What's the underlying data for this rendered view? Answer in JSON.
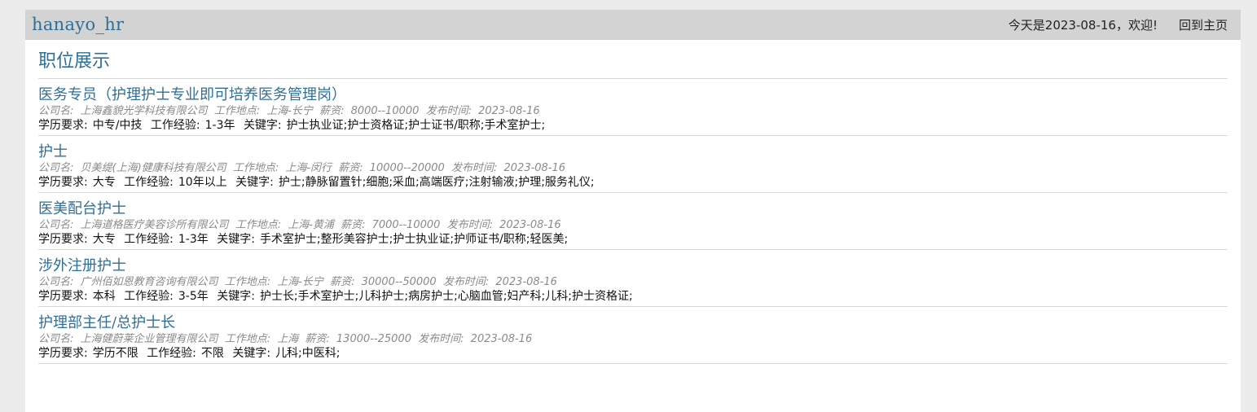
{
  "header": {
    "brand": "hanayo_hr",
    "greeting": "今天是2023-08-16，欢迎!",
    "home_link": "回到主页"
  },
  "main": {
    "section_title": "职位展示",
    "labels": {
      "company": "公司名:",
      "location": "工作地点:",
      "salary": "薪资:",
      "date": "发布时间:",
      "education": "学历要求:",
      "experience": "工作经验:",
      "keywords": "关键字:"
    },
    "jobs": [
      {
        "title": "医务专员（护理护士专业即可培养医务管理岗）",
        "company": "上海鑫貌光学科技有限公司",
        "location": "上海-长宁",
        "salary": "8000--10000",
        "date": "2023-08-16",
        "education": "中专/中技",
        "experience": "1-3年",
        "keywords": "护士执业证;护士资格证;护士证书/职称;手术室护士;"
      },
      {
        "title": "护士",
        "company": "贝美缇(上海)健康科技有限公司",
        "location": "上海-闵行",
        "salary": "10000--20000",
        "date": "2023-08-16",
        "education": "大专",
        "experience": "10年以上",
        "keywords": "护士;静脉留置针;细胞;采血;高端医疗;注射输液;护理;服务礼仪;"
      },
      {
        "title": "医美配台护士",
        "company": "上海道格医疗美容诊所有限公司",
        "location": "上海-黄浦",
        "salary": "7000--10000",
        "date": "2023-08-16",
        "education": "大专",
        "experience": "1-3年",
        "keywords": "手术室护士;整形美容护士;护士执业证;护师证书/职称;轻医美;"
      },
      {
        "title": "涉外注册护士",
        "company": "广州佰如恩教育咨询有限公司",
        "location": "上海-长宁",
        "salary": "30000--50000",
        "date": "2023-08-16",
        "education": "本科",
        "experience": "3-5年",
        "keywords": "护士长;手术室护士;儿科护士;病房护士;心脑血管;妇产科;儿科;护士资格证;"
      },
      {
        "title": "护理部主任/总护士长",
        "company": "上海健蔚莱企业管理有限公司",
        "location": "上海",
        "salary": "13000--25000",
        "date": "2023-08-16",
        "education": "学历不限",
        "experience": "不限",
        "keywords": "儿科;中医科;"
      }
    ]
  },
  "colors": {
    "brand": "#2f6f97",
    "topbar_bg": "#d3d3d3",
    "page_bg": "#ececec",
    "meta_text": "#8a8a8a"
  }
}
